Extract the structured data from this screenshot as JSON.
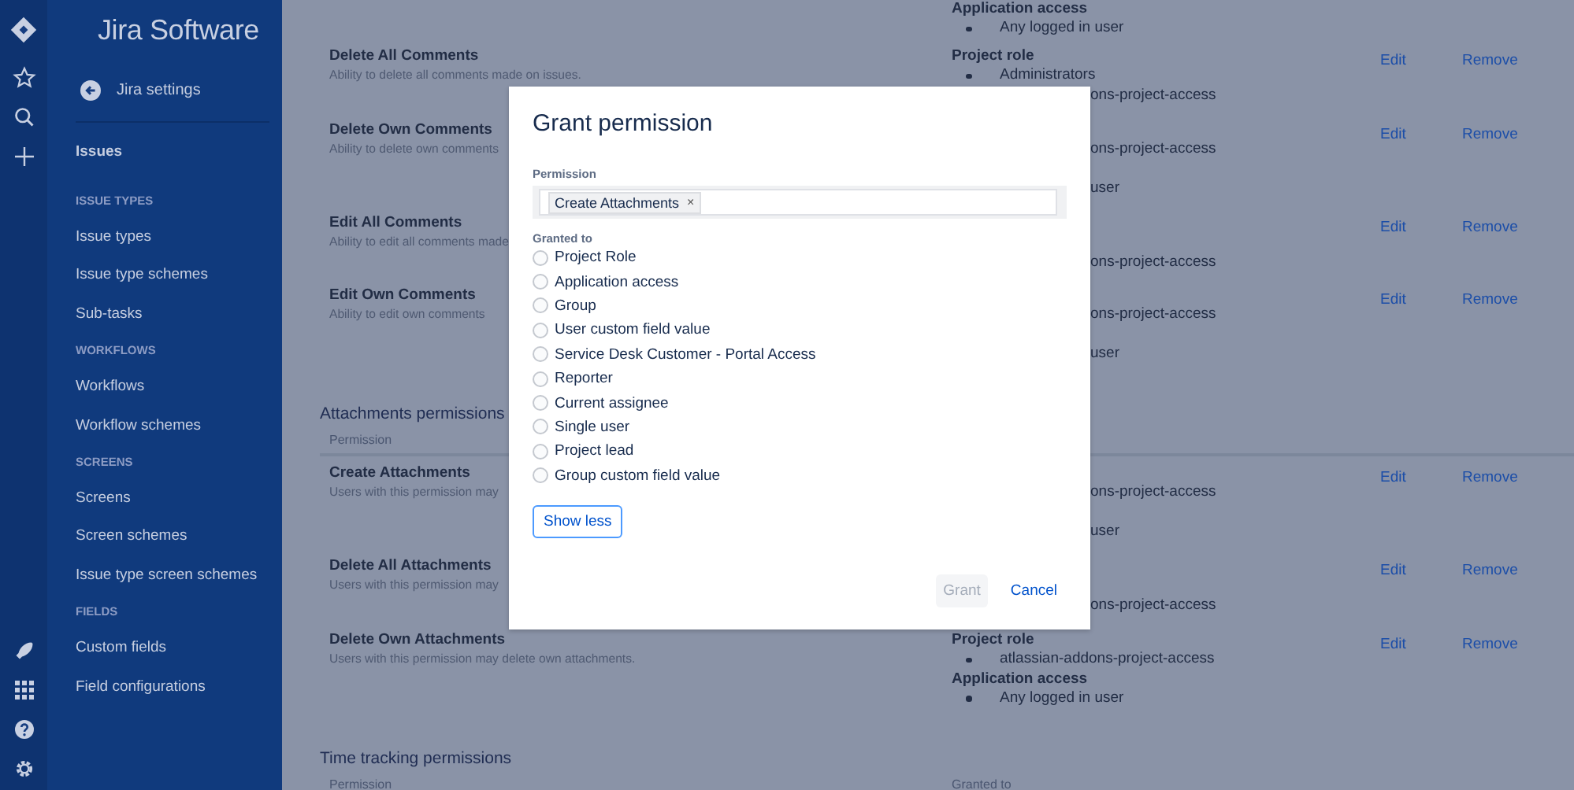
{
  "sidebar": {
    "title": "Jira Software",
    "back_link": "Jira settings",
    "top_items": [
      {
        "label": "Issues"
      }
    ],
    "groups": [
      {
        "heading": "ISSUE TYPES",
        "items": [
          {
            "label": "Issue types"
          },
          {
            "label": "Issue type schemes"
          },
          {
            "label": "Sub-tasks"
          }
        ]
      },
      {
        "heading": "WORKFLOWS",
        "items": [
          {
            "label": "Workflows"
          },
          {
            "label": "Workflow schemes"
          }
        ]
      },
      {
        "heading": "SCREENS",
        "items": [
          {
            "label": "Screens"
          },
          {
            "label": "Screen schemes"
          },
          {
            "label": "Issue type screen schemes"
          }
        ]
      },
      {
        "heading": "FIELDS",
        "items": [
          {
            "label": "Custom fields"
          },
          {
            "label": "Field configurations"
          }
        ]
      }
    ]
  },
  "main": {
    "top_grants": [
      {
        "kind": "heading",
        "text": "Application access"
      },
      {
        "kind": "bullet",
        "text": "Any logged in user"
      }
    ],
    "sections": [
      {
        "rows": [
          {
            "name": "Delete All Comments",
            "description": "Ability to delete all comments made on issues.",
            "grants": [
              {
                "kind": "heading",
                "text": "Project role"
              },
              {
                "kind": "bullet",
                "text": "Administrators"
              },
              {
                "kind": "fragment",
                "text": "ons-project-access"
              }
            ],
            "edit": "Edit",
            "remove": "Remove"
          },
          {
            "name": "Delete Own Comments",
            "description": "Ability to delete own comments",
            "grants": [
              {
                "kind": "fragment",
                "text": "ons-project-access"
              },
              {
                "kind": "fragment",
                "text": "user"
              }
            ],
            "edit": "Edit",
            "remove": "Remove"
          },
          {
            "name": "Edit All Comments",
            "description": "Ability to edit all comments made",
            "grants": [
              {
                "kind": "fragment",
                "text": "ons-project-access"
              }
            ],
            "edit": "Edit",
            "remove": "Remove"
          },
          {
            "name": "Edit Own Comments",
            "description": "Ability to edit own comments",
            "grants": [
              {
                "kind": "fragment",
                "text": "ons-project-access"
              },
              {
                "kind": "fragment",
                "text": "user"
              }
            ],
            "edit": "Edit",
            "remove": "Remove"
          }
        ]
      },
      {
        "title": "Attachments permissions",
        "header": {
          "permission": "Permission"
        },
        "rows": [
          {
            "name": "Create Attachments",
            "description": "Users with this permission may",
            "grants": [
              {
                "kind": "fragment",
                "text": "ons-project-access"
              },
              {
                "kind": "fragment",
                "text": "user"
              }
            ],
            "edit": "Edit",
            "remove": "Remove"
          },
          {
            "name": "Delete All Attachments",
            "description": "Users with this permission may",
            "grants": [
              {
                "kind": "fragment",
                "text": "ons-project-access"
              }
            ],
            "edit": "Edit",
            "remove": "Remove"
          },
          {
            "name": "Delete Own Attachments",
            "description": "Users with this permission may delete own attachments.",
            "grants": [
              {
                "kind": "heading",
                "text": "Project role"
              },
              {
                "kind": "bullet",
                "text": "atlassian-addons-project-access"
              },
              {
                "kind": "heading",
                "text": "Application access"
              },
              {
                "kind": "bullet",
                "text": "Any logged in user"
              }
            ],
            "edit": "Edit",
            "remove": "Remove"
          }
        ]
      },
      {
        "title": "Time tracking permissions",
        "header": {
          "permission": "Permission",
          "granted_to": "Granted to"
        }
      }
    ]
  },
  "dialog": {
    "title": "Grant permission",
    "permission_label": "Permission",
    "permission_tags": [
      {
        "label": "Create Attachments",
        "remove": "×"
      }
    ],
    "granted_label": "Granted to",
    "options": [
      {
        "label": "Project Role",
        "selected": false
      },
      {
        "label": "Application access",
        "selected": false
      },
      {
        "label": "Group",
        "selected": false
      },
      {
        "label": "User custom field value",
        "selected": false
      },
      {
        "label": "Service Desk Customer - Portal Access",
        "selected": false
      },
      {
        "label": "Reporter",
        "selected": false
      },
      {
        "label": "Current assignee",
        "selected": false
      },
      {
        "label": "Single user",
        "selected": false
      },
      {
        "label": "Project lead",
        "selected": false
      },
      {
        "label": "Group custom field value",
        "selected": false
      }
    ],
    "toggle": "Show less",
    "grant": {
      "label": "Grant",
      "disabled": true
    },
    "cancel": "Cancel"
  }
}
